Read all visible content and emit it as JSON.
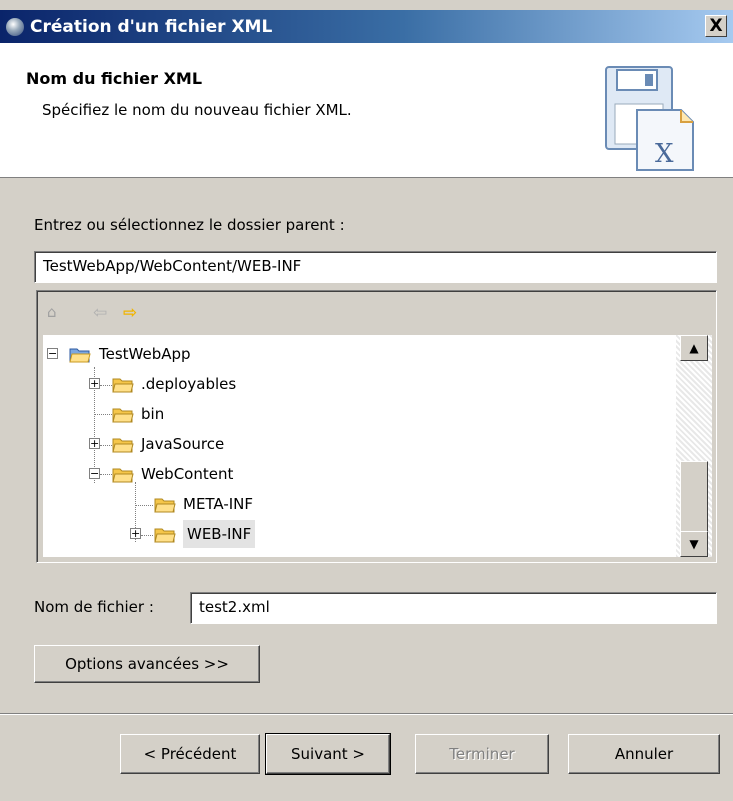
{
  "window": {
    "title": "Création d'un fichier XML",
    "close_label": "X"
  },
  "banner": {
    "heading": "Nom du fichier XML",
    "description": "Spécifiez le nom du nouveau fichier XML."
  },
  "parent_folder": {
    "label": "Entrez ou sélectionnez le dossier parent :",
    "value": "TestWebApp/WebContent/WEB-INF"
  },
  "tree": {
    "toolbar": [
      "home-icon",
      "back-arrow-icon",
      "forward-arrow-icon"
    ],
    "items": [
      {
        "label": "TestWebApp",
        "expander": "−"
      },
      {
        "label": ".deployables",
        "expander": "+"
      },
      {
        "label": "bin",
        "expander": ""
      },
      {
        "label": "JavaSource",
        "expander": "+"
      },
      {
        "label": "WebContent",
        "expander": "−"
      },
      {
        "label": "META-INF",
        "expander": ""
      },
      {
        "label": "WEB-INF",
        "expander": "+",
        "selected": true
      }
    ]
  },
  "file_name": {
    "label": "Nom de fichier :",
    "value": "test2.xml"
  },
  "advanced_button": "Options avancées >>",
  "buttons": {
    "back": "< Précédent",
    "next": "Suivant >",
    "finish": "Terminer",
    "cancel": "Annuler"
  },
  "colors": {
    "titlebar_start": "#0a246a",
    "titlebar_end": "#a6caf0",
    "dialog_bg": "#d4d0c8",
    "folder_yellow": "#f5c64a",
    "forward_arrow": "#f0b400"
  }
}
